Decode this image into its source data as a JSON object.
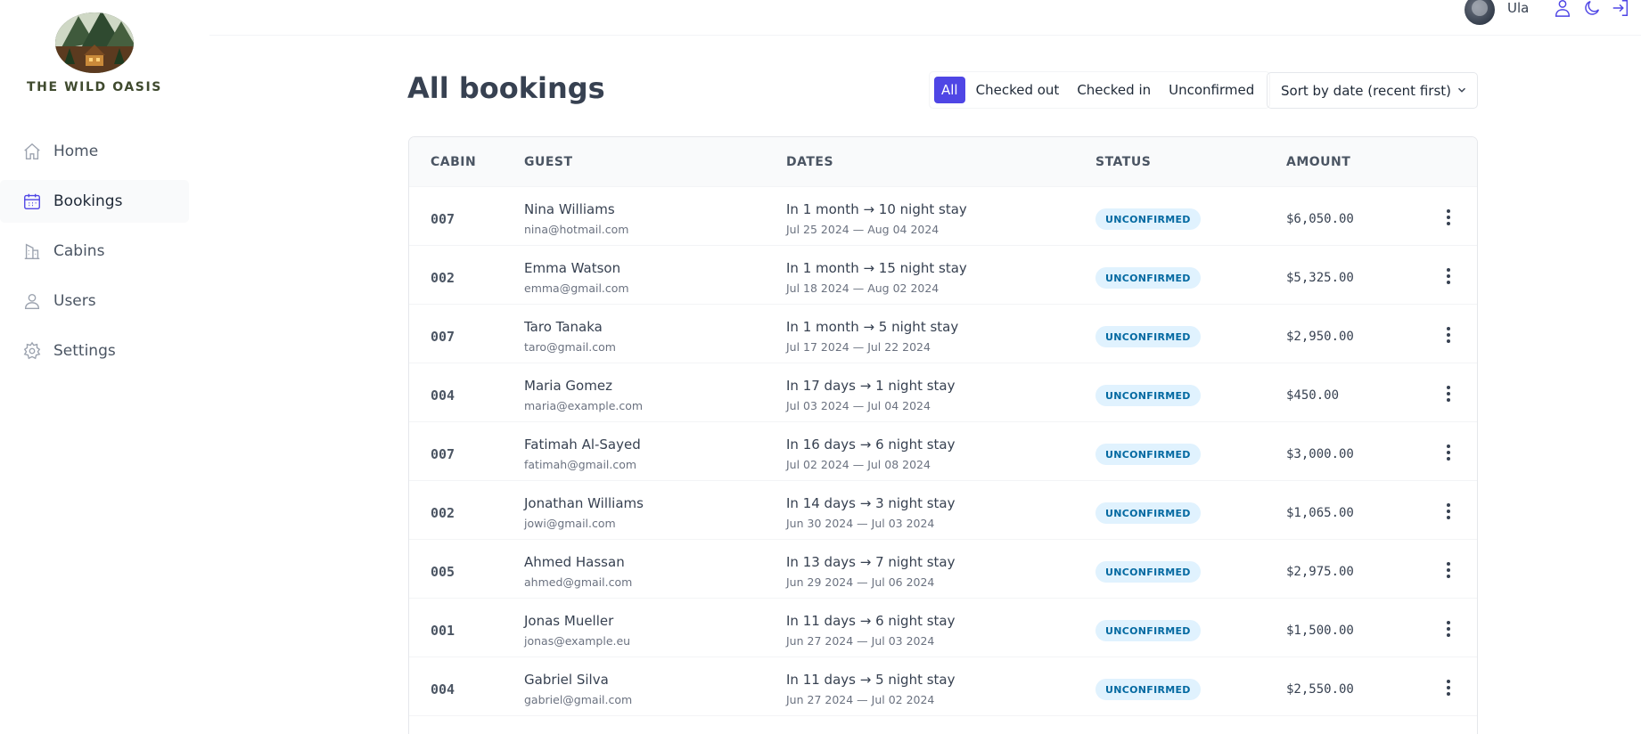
{
  "brand": {
    "name": "THE WILD OASIS"
  },
  "nav": [
    {
      "label": "Home",
      "icon": "home-icon",
      "active": false
    },
    {
      "label": "Bookings",
      "icon": "calendar-icon",
      "active": true
    },
    {
      "label": "Cabins",
      "icon": "building-icon",
      "active": false
    },
    {
      "label": "Users",
      "icon": "user-icon",
      "active": false
    },
    {
      "label": "Settings",
      "icon": "gear-icon",
      "active": false
    }
  ],
  "header": {
    "username": "Ula"
  },
  "page": {
    "title": "All bookings"
  },
  "filters": [
    {
      "label": "All",
      "active": true
    },
    {
      "label": "Checked out",
      "active": false
    },
    {
      "label": "Checked in",
      "active": false
    },
    {
      "label": "Unconfirmed",
      "active": false
    }
  ],
  "sort": {
    "selected": "Sort by date (recent first)"
  },
  "table": {
    "columns": [
      "CABIN",
      "GUEST",
      "DATES",
      "STATUS",
      "AMOUNT"
    ],
    "rows": [
      {
        "cabin": "007",
        "name": "Nina Williams",
        "email": "nina@hotmail.com",
        "relative": "In 1 month → 10 night stay",
        "range": "Jul 25 2024 — Aug 04 2024",
        "status": "UNCONFIRMED",
        "amount": "$6,050.00"
      },
      {
        "cabin": "002",
        "name": "Emma Watson",
        "email": "emma@gmail.com",
        "relative": "In 1 month → 15 night stay",
        "range": "Jul 18 2024 — Aug 02 2024",
        "status": "UNCONFIRMED",
        "amount": "$5,325.00"
      },
      {
        "cabin": "007",
        "name": "Taro Tanaka",
        "email": "taro@gmail.com",
        "relative": "In 1 month → 5 night stay",
        "range": "Jul 17 2024 — Jul 22 2024",
        "status": "UNCONFIRMED",
        "amount": "$2,950.00"
      },
      {
        "cabin": "004",
        "name": "Maria Gomez",
        "email": "maria@example.com",
        "relative": "In 17 days → 1 night stay",
        "range": "Jul 03 2024 — Jul 04 2024",
        "status": "UNCONFIRMED",
        "amount": "$450.00"
      },
      {
        "cabin": "007",
        "name": "Fatimah Al-Sayed",
        "email": "fatimah@gmail.com",
        "relative": "In 16 days → 6 night stay",
        "range": "Jul 02 2024 — Jul 08 2024",
        "status": "UNCONFIRMED",
        "amount": "$3,000.00"
      },
      {
        "cabin": "002",
        "name": "Jonathan Williams",
        "email": "jowi@gmail.com",
        "relative": "In 14 days → 3 night stay",
        "range": "Jun 30 2024 — Jul 03 2024",
        "status": "UNCONFIRMED",
        "amount": "$1,065.00"
      },
      {
        "cabin": "005",
        "name": "Ahmed Hassan",
        "email": "ahmed@gmail.com",
        "relative": "In 13 days → 7 night stay",
        "range": "Jun 29 2024 — Jul 06 2024",
        "status": "UNCONFIRMED",
        "amount": "$2,975.00"
      },
      {
        "cabin": "001",
        "name": "Jonas Mueller",
        "email": "jonas@example.eu",
        "relative": "In 11 days → 6 night stay",
        "range": "Jun 27 2024 — Jul 03 2024",
        "status": "UNCONFIRMED",
        "amount": "$1,500.00"
      },
      {
        "cabin": "004",
        "name": "Gabriel Silva",
        "email": "gabriel@gmail.com",
        "relative": "In 11 days → 5 night stay",
        "range": "Jun 27 2024 — Jul 02 2024",
        "status": "UNCONFIRMED",
        "amount": "$2,550.00"
      }
    ]
  },
  "colors": {
    "accent": "#4f46e5",
    "status_bg": "#e0f2fe",
    "status_fg": "#0369a1"
  }
}
